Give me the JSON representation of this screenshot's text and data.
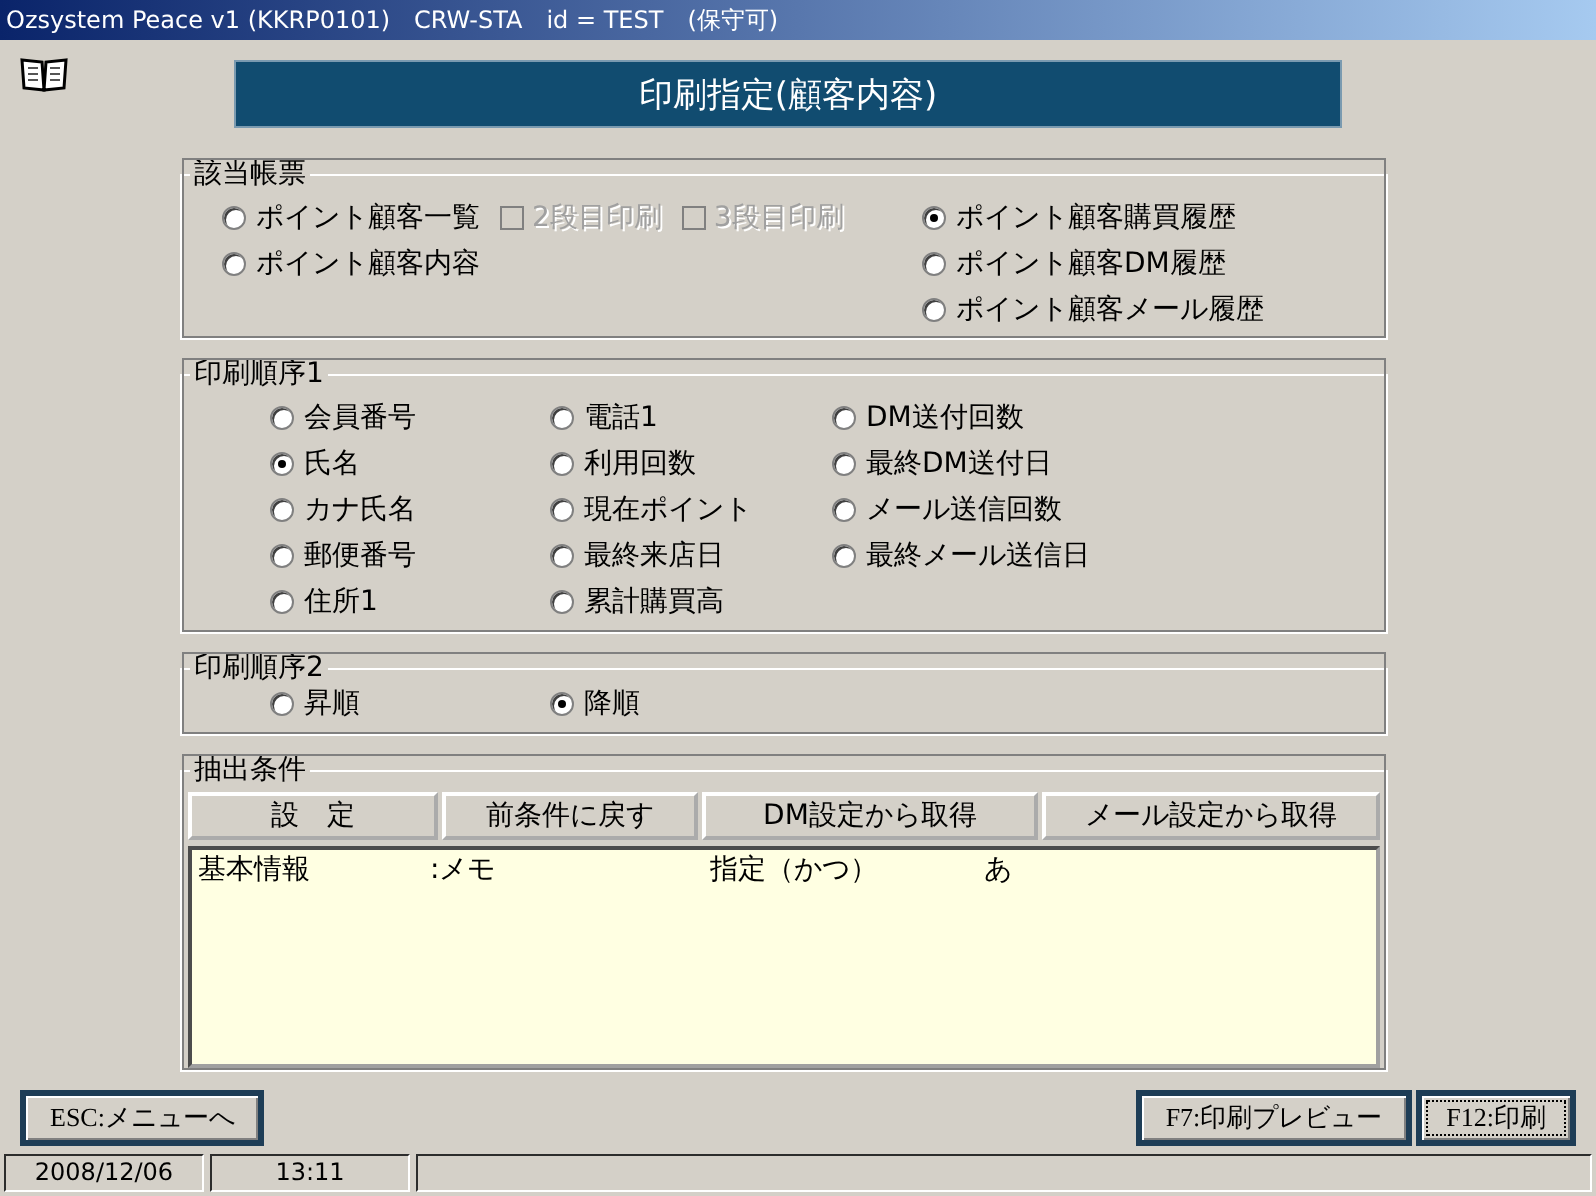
{
  "window": {
    "title": "Ozsystem Peace v1 (KKRP0101)　CRW-STA　id = TEST　(保守可)"
  },
  "header": {
    "title": "印刷指定(顧客内容)"
  },
  "report": {
    "title": "該当帳票",
    "items": [
      {
        "label": "ポイント顧客一覧",
        "selected": false
      },
      {
        "label": "ポイント顧客内容",
        "selected": false
      },
      {
        "label": "ポイント顧客購買履歴",
        "selected": true
      },
      {
        "label": "ポイント顧客DM履歴",
        "selected": false
      },
      {
        "label": "ポイント顧客メール履歴",
        "selected": false
      }
    ],
    "print_options": [
      {
        "label": "2段目印刷",
        "checked": false,
        "disabled": true
      },
      {
        "label": "3段目印刷",
        "checked": false,
        "disabled": true
      }
    ]
  },
  "sort1": {
    "title": "印刷順序1",
    "items": [
      {
        "label": "会員番号",
        "selected": false
      },
      {
        "label": "電話1",
        "selected": false
      },
      {
        "label": "DM送付回数",
        "selected": false
      },
      {
        "label": "氏名",
        "selected": true
      },
      {
        "label": "利用回数",
        "selected": false
      },
      {
        "label": "最終DM送付日",
        "selected": false
      },
      {
        "label": "カナ氏名",
        "selected": false
      },
      {
        "label": "現在ポイント",
        "selected": false
      },
      {
        "label": "メール送信回数",
        "selected": false
      },
      {
        "label": "郵便番号",
        "selected": false
      },
      {
        "label": "最終来店日",
        "selected": false
      },
      {
        "label": "最終メール送信日",
        "selected": false
      },
      {
        "label": "住所1",
        "selected": false
      },
      {
        "label": "累計購買高",
        "selected": false
      }
    ]
  },
  "sort2": {
    "title": "印刷順序2",
    "items": [
      {
        "label": "昇順",
        "selected": false
      },
      {
        "label": "降順",
        "selected": true
      }
    ]
  },
  "conditions": {
    "title": "抽出条件",
    "buttons": [
      "設　定",
      "前条件に戻す",
      "DM設定から取得",
      "メール設定から取得"
    ],
    "rows": [
      {
        "cells": [
          "基本情報",
          ":メモ",
          "指定（かつ）",
          "あ"
        ]
      }
    ]
  },
  "footer": {
    "buttons": [
      {
        "label": "ESC:メニューへ",
        "focused": false
      },
      {
        "label": "F7:印刷プレビュー",
        "focused": false
      },
      {
        "label": "F12:印刷",
        "focused": true
      }
    ]
  },
  "status_bar": [
    "2008/12/06",
    "13:11"
  ]
}
